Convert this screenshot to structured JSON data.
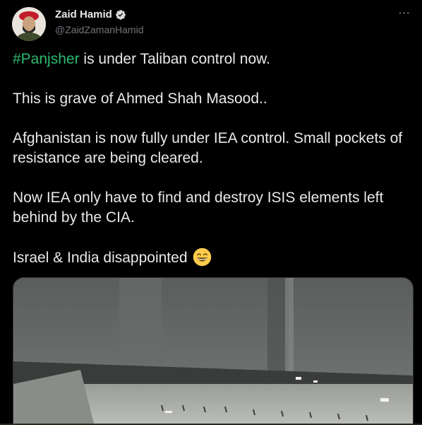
{
  "tweet": {
    "author": {
      "display_name": "Zaid Hamid",
      "handle": "@ZaidZamanHamid",
      "verified": true
    },
    "more_label": "···",
    "hashtag": "#Panjsher",
    "line1_rest": " is under Taliban control now.",
    "para2": "This is grave of Ahmed Shah Masood..",
    "para3": "Afghanistan is now fully under IEA control. Small pockets of resistance are being cleared.",
    "para4": "Now IEA only have to find and destroy ISIS elements left behind by the CIA.",
    "para5": "Israel & India disappointed",
    "emoji": "grinning-face-with-smiling-eyes",
    "media": {
      "type": "video-thumbnail"
    }
  },
  "colors": {
    "background": "#000000",
    "text": "#e7e9ea",
    "secondary_text": "#71767b",
    "hashtag": "#2bba6e",
    "verified_badge": "#d9d9d9"
  }
}
